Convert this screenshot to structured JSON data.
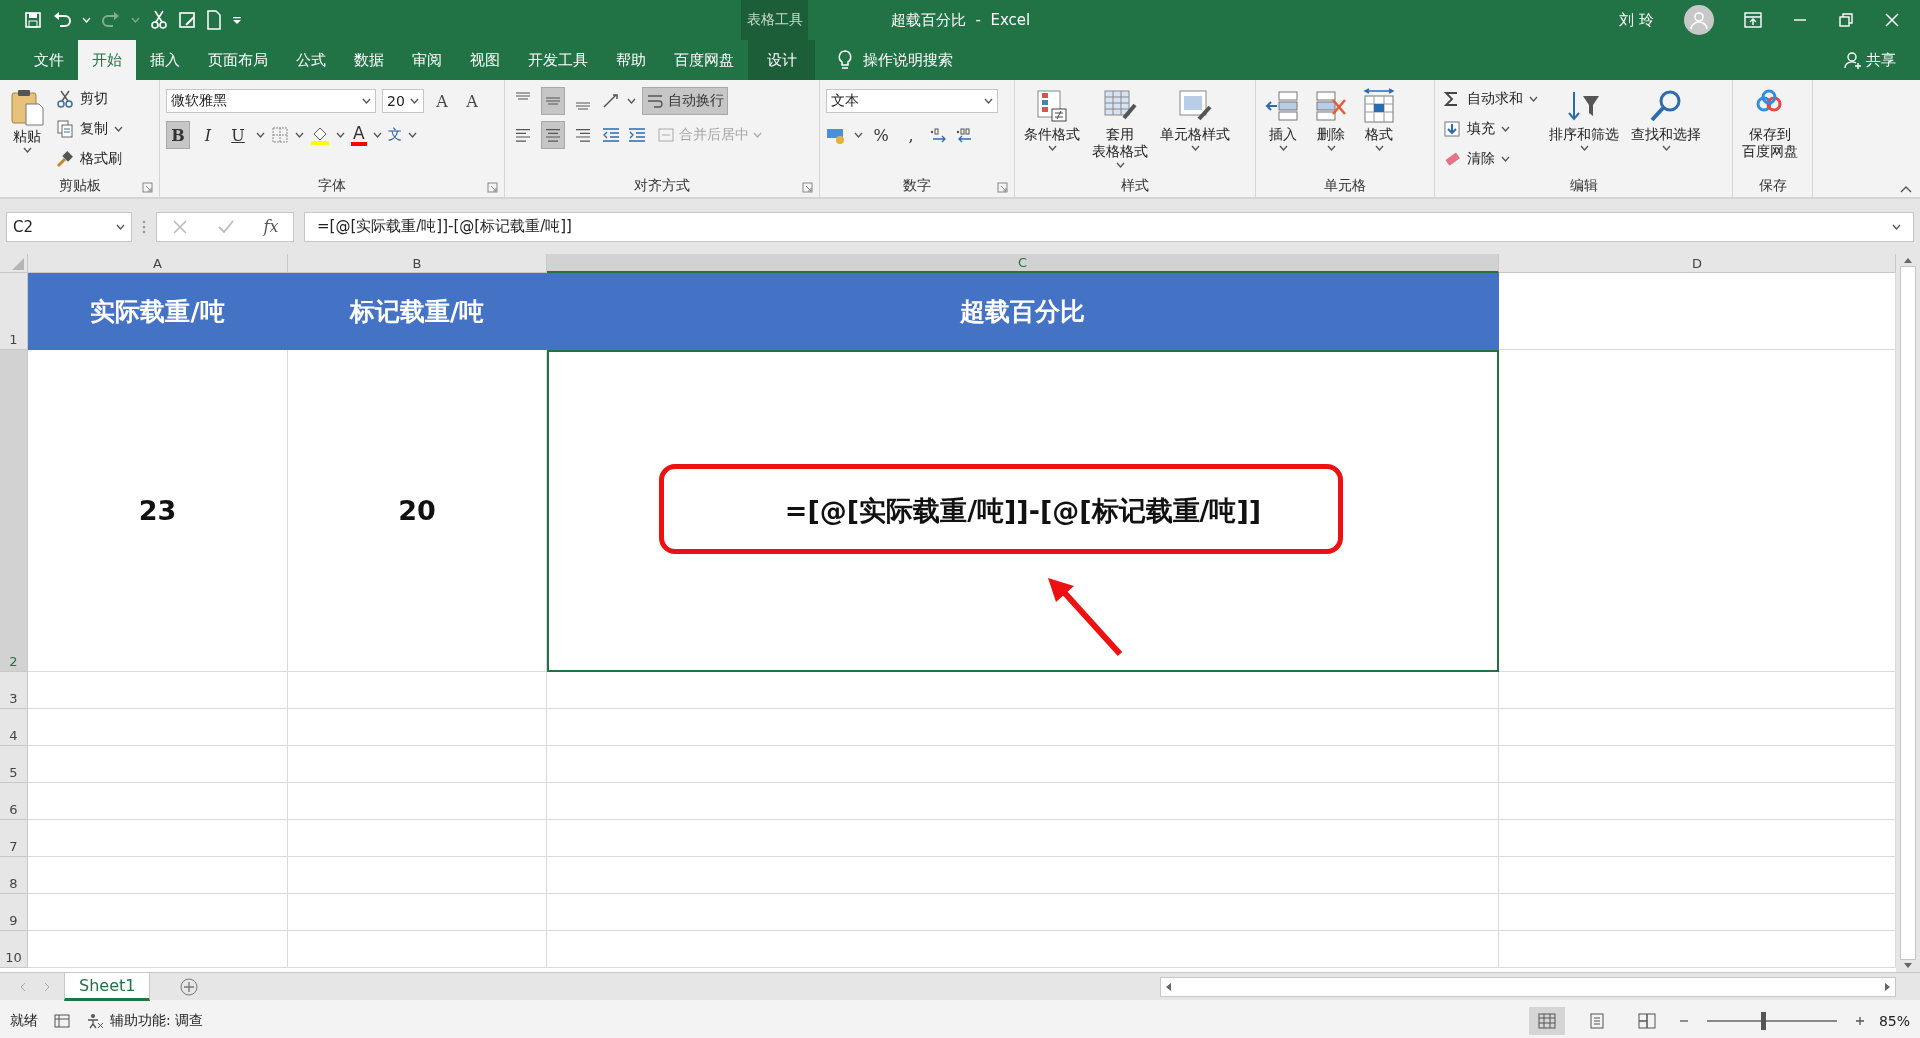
{
  "window": {
    "title": "超载百分比  -  Excel",
    "context_label": "表格工具",
    "user": "刘 玲"
  },
  "ribbon_tabs": [
    {
      "label": "文件",
      "selected": false,
      "kind": "normal"
    },
    {
      "label": "开始",
      "selected": true,
      "kind": "normal"
    },
    {
      "label": "插入",
      "selected": false,
      "kind": "normal"
    },
    {
      "label": "页面布局",
      "selected": false,
      "kind": "normal"
    },
    {
      "label": "公式",
      "selected": false,
      "kind": "normal"
    },
    {
      "label": "数据",
      "selected": false,
      "kind": "normal"
    },
    {
      "label": "审阅",
      "selected": false,
      "kind": "normal"
    },
    {
      "label": "视图",
      "selected": false,
      "kind": "normal"
    },
    {
      "label": "开发工具",
      "selected": false,
      "kind": "normal"
    },
    {
      "label": "帮助",
      "selected": false,
      "kind": "normal"
    },
    {
      "label": "百度网盘",
      "selected": false,
      "kind": "normal"
    },
    {
      "label": "设计",
      "selected": false,
      "kind": "context"
    }
  ],
  "tell_me": "操作说明搜索",
  "share": "共享",
  "ribbon_groups": [
    {
      "kind": "clipboard",
      "label": "剪贴板",
      "paste": "粘贴",
      "items": [
        "剪切",
        "复制",
        "格式刷"
      ]
    },
    {
      "kind": "font",
      "label": "字体",
      "font_name": "微软雅黑",
      "font_size": "20",
      "size_glyphs": [
        "A",
        "A"
      ],
      "format_buttons": [
        {
          "label": "B",
          "pressed": true
        },
        {
          "label": "I",
          "pressed": false
        },
        {
          "label": "U",
          "pressed": false
        }
      ],
      "font_color_glyph": "A",
      "phonetic_glyph": "文"
    },
    {
      "kind": "alignment",
      "label": "对齐方式",
      "vertical_buttons": [
        {
          "selected": false
        },
        {
          "selected": true
        },
        {
          "selected": false
        }
      ],
      "horizontal_buttons": [
        {
          "selected": false
        },
        {
          "selected": true
        },
        {
          "selected": false
        }
      ],
      "wrap_text": {
        "label": "自动换行",
        "on": true
      },
      "merge": {
        "label": "合并后居中",
        "disabled": true
      }
    },
    {
      "kind": "number",
      "label": "数字",
      "format": "文本",
      "symbols": [
        "%",
        ","
      ]
    },
    {
      "kind": "styles",
      "label": "样式",
      "buttons": [
        [
          "条件格式"
        ],
        [
          "套用",
          "表格格式"
        ],
        [
          "单元格样式"
        ]
      ]
    },
    {
      "kind": "cells",
      "label": "单元格",
      "buttons": [
        [
          "插入"
        ],
        [
          "删除"
        ],
        [
          "格式"
        ]
      ]
    },
    {
      "kind": "editing",
      "label": "编辑",
      "items": [
        "自动求和",
        "填充",
        "清除"
      ],
      "buttons": [
        [
          "排序和筛选"
        ],
        [
          "查找和选择"
        ]
      ]
    },
    {
      "kind": "save",
      "label": "保存",
      "buttons": [
        [
          "保存到",
          "百度网盘"
        ]
      ]
    }
  ],
  "formula_bar": {
    "name_box": "C2",
    "function_glyph": "fx",
    "formula": "=[@[实际载重/吨]]-[@[标记载重/吨]]"
  },
  "sheet": {
    "columns": [
      {
        "label": "A",
        "selected": false
      },
      {
        "label": "B",
        "selected": false
      },
      {
        "label": "C",
        "selected": true
      },
      {
        "label": "D",
        "selected": false
      }
    ],
    "rows": [
      {
        "number": "1",
        "kind": "header",
        "selected": false,
        "cells": [
          {
            "text": "实际载重/吨",
            "active": false
          },
          {
            "text": "标记载重/吨",
            "active": false
          },
          {
            "text": "超载百分比",
            "active": false
          }
        ]
      },
      {
        "number": "2",
        "kind": "data",
        "selected": true,
        "cells": [
          {
            "text": "23",
            "active": false
          },
          {
            "text": "20",
            "active": false
          },
          {
            "text": "=[@[实际载重/吨]]-[@[标记载重/吨]]",
            "active": true
          }
        ]
      },
      {
        "number": "3",
        "kind": "data",
        "selected": false
      },
      {
        "number": "4",
        "kind": "data",
        "selected": false
      },
      {
        "number": "5",
        "kind": "data",
        "selected": false
      },
      {
        "number": "6",
        "kind": "data",
        "selected": false
      },
      {
        "number": "7",
        "kind": "data",
        "selected": false
      },
      {
        "number": "8",
        "kind": "data",
        "selected": false
      },
      {
        "number": "9",
        "kind": "data",
        "selected": false
      },
      {
        "number": "10",
        "kind": "data",
        "selected": false
      }
    ]
  },
  "sheet_tabs": [
    {
      "label": "Sheet1",
      "selected": true
    }
  ],
  "status_bar": {
    "mode": "就绪",
    "accessibility": "辅助功能: 调查",
    "views": [
      {
        "kind": "normal",
        "selected": true
      },
      {
        "kind": "page-layout",
        "selected": false
      },
      {
        "kind": "page-break",
        "selected": false
      }
    ],
    "zoom": "85%",
    "zoom_slider": {
      "level": 0.42
    }
  }
}
